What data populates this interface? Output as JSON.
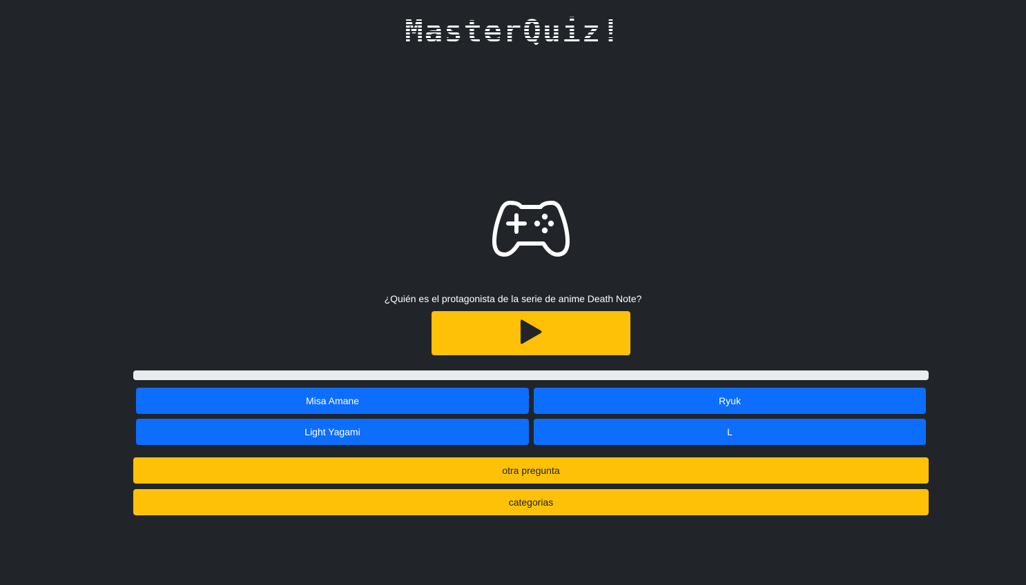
{
  "app": {
    "title": "MasterQuiz!"
  },
  "quiz": {
    "question": "¿Quién es el protagonista de la serie de anime Death Note?",
    "play_icon": "play-icon",
    "progress_fraction": 0.0,
    "answers": [
      {
        "label": "Misa Amane"
      },
      {
        "label": "Ryuk"
      },
      {
        "label": "Light Yagami"
      },
      {
        "label": "L"
      }
    ]
  },
  "actions": {
    "next_label": "otra pregunta",
    "categories_label": "categorias"
  },
  "icons": {
    "hero": "gamepad-icon"
  },
  "colors": {
    "background": "#212529",
    "answer_button": "#0d6efd",
    "accent_button": "#ffc107",
    "progress_track": "#e9ecef"
  }
}
